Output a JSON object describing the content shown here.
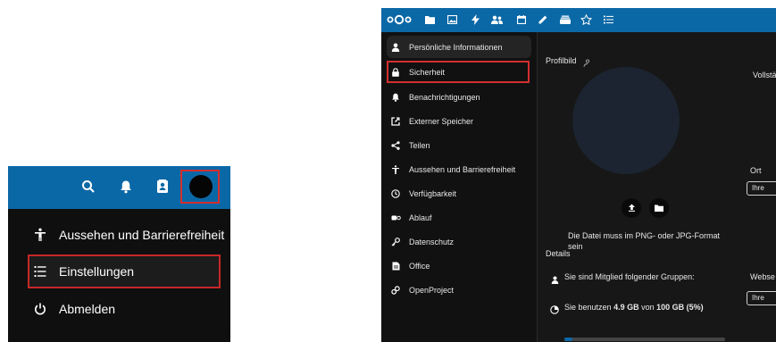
{
  "colors": {
    "header_blue": "#0b68a6",
    "highlight_red": "#d32f2f",
    "dark_bg": "#171717",
    "menu_bg": "#0f0f0f"
  },
  "left": {
    "header_icons": [
      "search-icon",
      "bell-icon",
      "contacts-icon",
      "avatar"
    ],
    "menu": {
      "appearance": "Aussehen und Barrierefreiheit",
      "settings": "Einstellungen",
      "logout": "Abmelden"
    }
  },
  "right": {
    "top_bar_icons": [
      "nextcloud-logo",
      "files-icon",
      "photos-icon",
      "activity-icon",
      "contacts-icon",
      "calendar-icon",
      "notes-icon",
      "deck-icon",
      "favorites-icon",
      "tasks-icon"
    ],
    "nav": [
      {
        "label": "Persönliche Informationen",
        "icon": "user-icon"
      },
      {
        "label": "Sicherheit",
        "icon": "lock-icon"
      },
      {
        "label": "Benachrichtigungen",
        "icon": "bell-icon"
      },
      {
        "label": "Externer Speicher",
        "icon": "external-link-icon"
      },
      {
        "label": "Teilen",
        "icon": "share-icon"
      },
      {
        "label": "Aussehen und Barrierefreiheit",
        "icon": "accessibility-icon"
      },
      {
        "label": "Verfügbarkeit",
        "icon": "clock-icon"
      },
      {
        "label": "Ablauf",
        "icon": "flow-icon"
      },
      {
        "label": "Datenschutz",
        "icon": "key-icon"
      },
      {
        "label": "Office",
        "icon": "document-icon"
      },
      {
        "label": "OpenProject",
        "icon": "link-icon"
      }
    ],
    "content": {
      "profile_picture_label": "Profilbild",
      "format_note": "Die Datei muss im PNG- oder JPG-Format sein",
      "details_label": "Details",
      "groups_text": "Sie sind Mitglied folgender Gruppen:",
      "storage_prefix": "Sie benutzen",
      "storage_used": "4.9 GB",
      "storage_mid": "von",
      "storage_total": "100 GB",
      "storage_percent": "(5%)",
      "storage_fraction": 0.05,
      "full_name_label": "Vollstä",
      "location_label": "Ort",
      "location_placeholder": "Ihre",
      "website_label": "Webse",
      "website_placeholder": "Ihre"
    }
  }
}
